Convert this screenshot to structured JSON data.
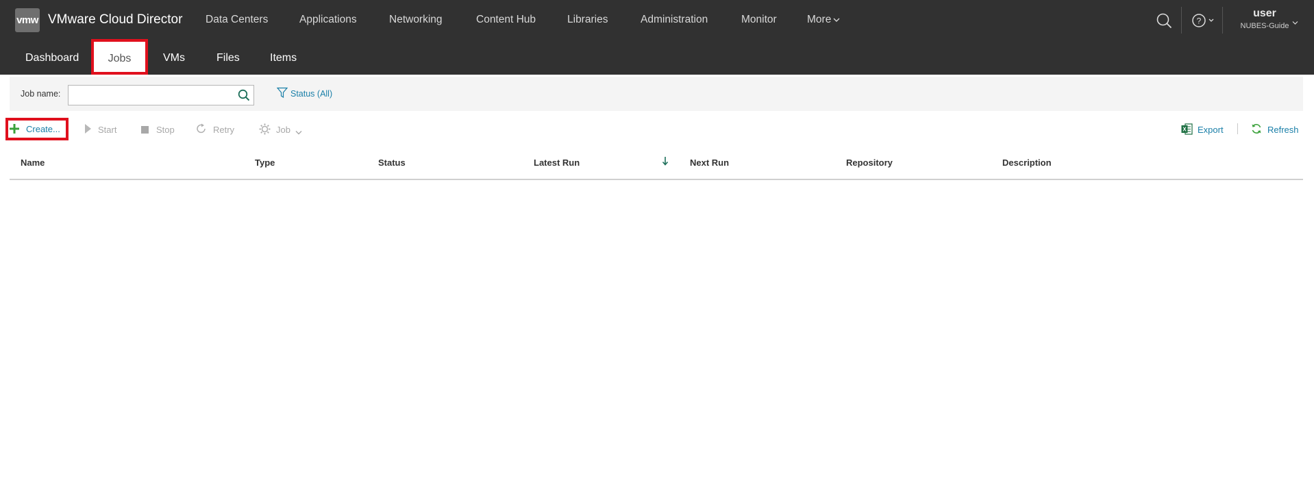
{
  "app": {
    "logo_text": "vmw",
    "title": "VMware Cloud Director"
  },
  "main_nav": [
    {
      "label": "Data Centers"
    },
    {
      "label": "Applications"
    },
    {
      "label": "Networking"
    },
    {
      "label": "Content Hub"
    },
    {
      "label": "Libraries"
    },
    {
      "label": "Administration"
    },
    {
      "label": "Monitor"
    },
    {
      "label": "More"
    }
  ],
  "user": {
    "name": "user",
    "org": "NUBES-Guide"
  },
  "sub_tabs": [
    {
      "label": "Dashboard"
    },
    {
      "label": "Jobs",
      "active": true
    },
    {
      "label": "VMs"
    },
    {
      "label": "Files"
    },
    {
      "label": "Items"
    }
  ],
  "filters": {
    "job_name_label": "Job name:",
    "job_name_value": "",
    "status_label": "Status (All)"
  },
  "toolbar": {
    "create": "Create...",
    "start": "Start",
    "stop": "Stop",
    "retry": "Retry",
    "job": "Job",
    "export": "Export",
    "refresh": "Refresh"
  },
  "grid": {
    "columns": [
      "Name",
      "Type",
      "Status",
      "Latest Run",
      "Next Run",
      "Repository",
      "Description"
    ],
    "sorted_column": "Latest Run",
    "sort_direction": "descending",
    "rows": []
  },
  "colors": {
    "header_bg": "#313131",
    "accent_link": "#1a7fa8",
    "highlight_red": "#e0101d",
    "create_plus": "#3aa13a",
    "excel_green": "#1d6f42",
    "refresh_green": "#3aa13a"
  },
  "icons": {
    "search": "search-icon",
    "help": "help-circle-icon",
    "filter": "funnel-icon",
    "create": "plus-icon",
    "start": "play-icon",
    "stop": "stop-icon",
    "retry": "retry-icon",
    "job": "gear-icon",
    "export": "excel-icon",
    "refresh": "refresh-icon",
    "sort": "arrow-down-icon"
  }
}
